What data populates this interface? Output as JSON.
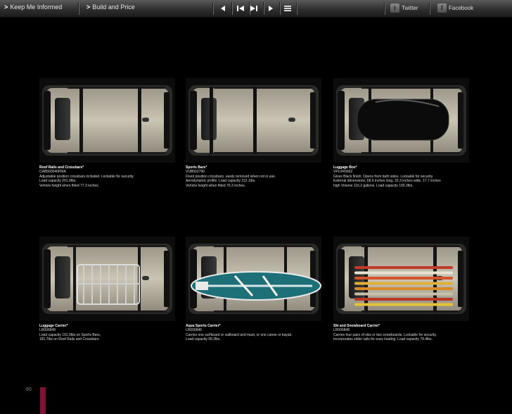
{
  "toolbar": {
    "keep_informed": "Keep Me Informed",
    "build_price": "Build and Price",
    "twitter": "Twitter",
    "facebook": "Facebook"
  },
  "page_number": "60",
  "accent_color": "#7d1236",
  "products": [
    {
      "title": "Roof Rails and Crossbars*",
      "code": "CAB500040PMA",
      "lines": [
        "Adjustable position crossbars included. Lockable for security.",
        "Load capacity 201.9lbs.",
        "Vehicle height when fitted 77.3 inches."
      ],
      "accessory": "crossbars"
    },
    {
      "title": "Sports Bars*",
      "code": "VUB502790",
      "lines": [
        "Fixed position crossbars, easily removed when not in use.",
        "Aerodynamic profile. Load capacity 212.1lbs.",
        "Vehicle height when fitted 76.3 inches."
      ],
      "accessory": "sports-bars"
    },
    {
      "title": "Luggage Box*",
      "code": "VPLVR0062",
      "lines": [
        "Gloss Black finish. Opens from both sides. Lockable for security.",
        "External dimensions: 68.9 inches long, 32.3 inches wide, 17.7 inches",
        "high Volume 116.2 gallons. Load capacity 165.3lbs."
      ],
      "accessory": "luggage-box"
    },
    {
      "title": "Luggage Carrier*",
      "code": "LR006849",
      "lines": [
        "Load capacity 191.9lbs on Sports Bars,",
        "181.7lbs on Roof Rails and Crossbars."
      ],
      "accessory": "luggage-carrier"
    },
    {
      "title": "Aqua Sports Carrier*",
      "code": "LR006846",
      "lines": [
        "Carries one surfboard or sailboard and mast, or one canoe or kayak.",
        "Load capacity 99.2lbs."
      ],
      "accessory": "surfboard"
    },
    {
      "title": "Ski and Snowboard Carrier*",
      "code": "LR006848",
      "lines": [
        "Carries four pairs of skis or two snowboards. Lockable for security.",
        "Incorporates slider rails for easy loading. Load capacity 79.4lbs."
      ],
      "accessory": "skis"
    }
  ]
}
